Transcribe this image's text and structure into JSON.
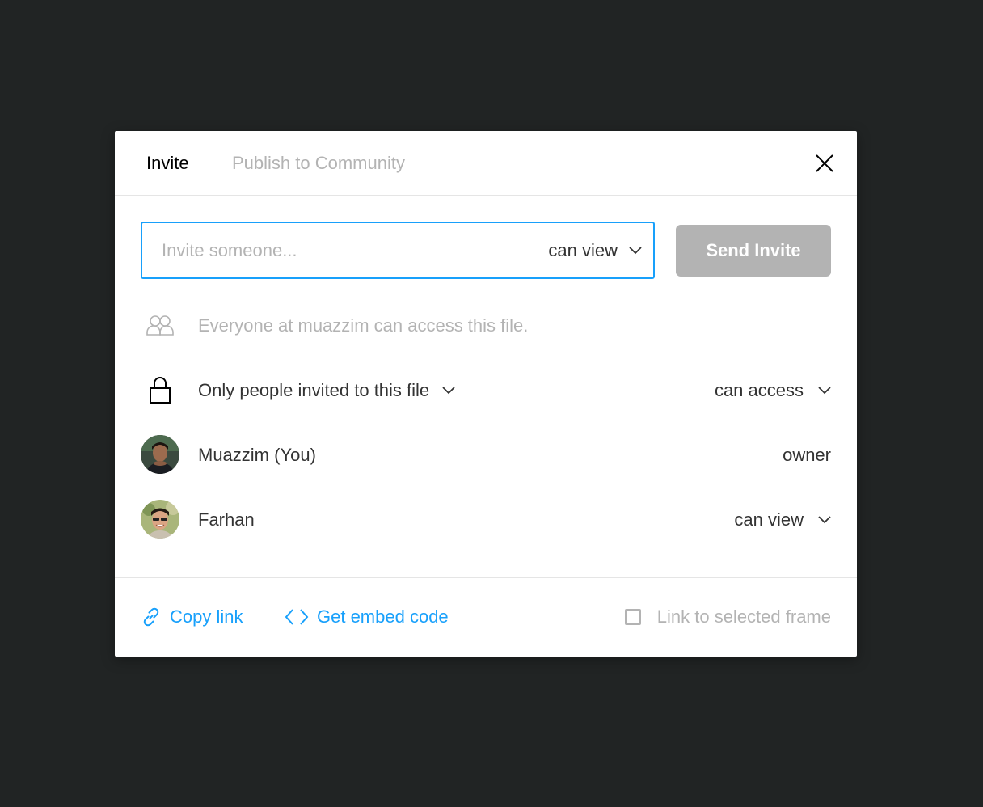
{
  "colors": {
    "backdrop": "#212424",
    "accent": "#18a0fb",
    "muted_text": "#b3b3b3",
    "primary_text": "#333333",
    "disabled_button": "#b3b3b3"
  },
  "tabs": [
    {
      "label": "Invite",
      "active": true
    },
    {
      "label": "Publish to Community",
      "active": false
    }
  ],
  "invite": {
    "placeholder": "Invite someone...",
    "value": "",
    "permission": "can view",
    "send_label": "Send Invite"
  },
  "org_access": {
    "icon": "people-icon",
    "text": "Everyone at muazzim can access this file."
  },
  "link_access": {
    "icon": "lock-icon",
    "scope": "Only people invited to this file",
    "permission": "can access"
  },
  "members": [
    {
      "name": "Muazzim (You)",
      "role": "owner",
      "editable": false,
      "icon": "avatar"
    },
    {
      "name": "Farhan",
      "role": "can view",
      "editable": true,
      "icon": "avatar"
    }
  ],
  "footer": {
    "copy_link": "Copy link",
    "embed_code": "Get embed code",
    "link_frame": "Link to selected frame",
    "link_frame_checked": false
  }
}
